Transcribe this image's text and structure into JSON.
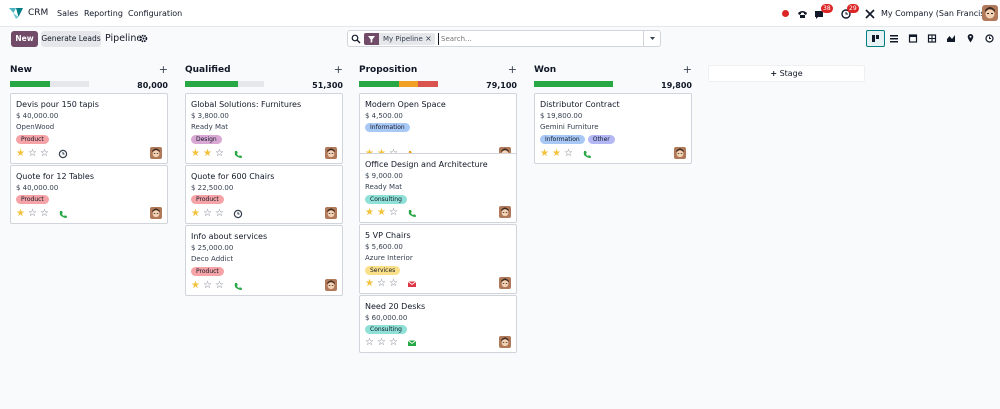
{
  "navbar": {
    "app_name": "CRM",
    "menu": [
      "Sales",
      "Reporting",
      "Configuration"
    ],
    "messages_count": "38",
    "activities_count": "29",
    "company": "My Company (San Francisco)"
  },
  "control": {
    "new_label": "New",
    "generate_label": "Generate Leads",
    "breadcrumb": "Pipeline",
    "facet_label": "My Pipeline",
    "search_placeholder": "Search...",
    "views": [
      "kanban-icon",
      "list-icon",
      "calendar-icon",
      "pivot-icon",
      "graph-icon",
      "map-icon",
      "activity-icon"
    ]
  },
  "columns": [
    {
      "title": "New",
      "total": "80,000",
      "progress": [
        {
          "color": "#28a745",
          "pct": 50
        },
        {
          "color": "#e5e7eb",
          "pct": 50
        }
      ],
      "cards": [
        {
          "title": "Devis pour 150 tapis",
          "amount": "$ 40,000.00",
          "sub": "OpenWood",
          "tags": [
            {
              "label": "Product",
              "color": "#f5a3a7"
            }
          ],
          "stars": 1,
          "activity": "clock-icon"
        },
        {
          "title": "Quote for 12 Tables",
          "amount": "$ 40,000.00",
          "sub": "",
          "tags": [
            {
              "label": "Product",
              "color": "#f5a3a7"
            }
          ],
          "stars": 1,
          "activity": "phone-icon"
        }
      ]
    },
    {
      "title": "Qualified",
      "total": "51,300",
      "progress": [
        {
          "color": "#28a745",
          "pct": 67
        },
        {
          "color": "#e5e7eb",
          "pct": 33
        }
      ],
      "cards": [
        {
          "title": "Global Solutions: Furnitures",
          "amount": "$ 3,800.00",
          "sub": "Ready Mat",
          "tags": [
            {
              "label": "Design",
              "color": "#d9a8d4"
            }
          ],
          "stars": 2,
          "activity": "phone-icon"
        },
        {
          "title": "Quote for 600 Chairs",
          "amount": "$ 22,500.00",
          "sub": "",
          "tags": [
            {
              "label": "Product",
              "color": "#f5a3a7"
            }
          ],
          "stars": 1,
          "activity": "clock-icon"
        },
        {
          "title": "Info about services",
          "amount": "$ 25,000.00",
          "sub": "Deco Addict",
          "tags": [
            {
              "label": "Product",
              "color": "#f5a3a7"
            }
          ],
          "stars": 1,
          "activity": "phone-icon"
        }
      ]
    },
    {
      "title": "Proposition",
      "total": "79,100",
      "progress": [
        {
          "color": "#28a745",
          "pct": 50
        },
        {
          "color": "#f0a024",
          "pct": 25
        },
        {
          "color": "#d9534f",
          "pct": 25
        }
      ],
      "cards": [
        {
          "title": "Modern Open Space",
          "amount": "$ 4,500.00",
          "sub": "",
          "tags": [
            {
              "label": "Information",
              "color": "#a8c8f5"
            }
          ],
          "stars": 2,
          "activity": "phone-orange-icon"
        },
        {
          "title": "Office Design and Architecture",
          "amount": "$ 9,000.00",
          "sub": "Ready Mat",
          "tags": [
            {
              "label": "Consulting",
              "color": "#8fe0d6"
            }
          ],
          "stars": 2,
          "activity": "phone-icon"
        },
        {
          "title": "5 VP Chairs",
          "amount": "$ 5,600.00",
          "sub": "Azure Interior",
          "tags": [
            {
              "label": "Services",
              "color": "#fbe08a"
            }
          ],
          "stars": 1,
          "activity": "email-red-icon"
        },
        {
          "title": "Need 20 Desks",
          "amount": "$ 60,000.00",
          "sub": "",
          "tags": [
            {
              "label": "Consulting",
              "color": "#8fe0d6"
            }
          ],
          "stars": 0,
          "activity": "email-icon"
        }
      ]
    },
    {
      "title": "Won",
      "total": "19,800",
      "progress": [
        {
          "color": "#28a745",
          "pct": 100
        }
      ],
      "cards": [
        {
          "title": "Distributor Contract",
          "amount": "$ 19,800.00",
          "sub": "Gemini Furniture",
          "tags": [
            {
              "label": "Information",
              "color": "#a8c8f5"
            },
            {
              "label": "Other",
              "color": "#b3b8f5"
            }
          ],
          "stars": 2,
          "activity": "phone-icon"
        }
      ]
    }
  ],
  "add_stage_label": "Stage"
}
